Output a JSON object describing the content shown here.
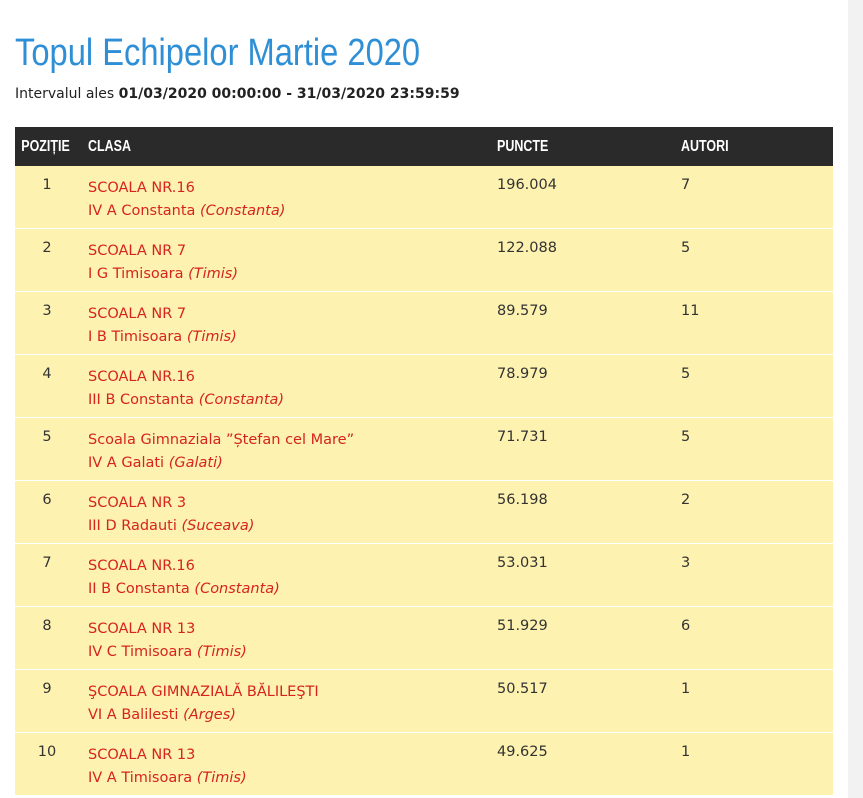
{
  "page": {
    "title": "Topul Echipelor Martie 2020",
    "interval_label": "Intervalul ales",
    "interval_range": "01/03/2020 00:00:00 - 31/03/2020 23:59:59"
  },
  "colors": {
    "title": "#2f8fd6",
    "header_bg": "#2a2a2a",
    "row_bg": "#fdf2b0",
    "link": "#d6241d"
  },
  "table": {
    "headers": {
      "position": "POZIȚIE",
      "class": "CLASA",
      "points": "PUNCTE",
      "authors": "AUTORI"
    },
    "rows": [
      {
        "position": "1",
        "school": "SCOALA NR.16",
        "class": "IV A Constanta",
        "county": "(Constanta)",
        "points": "196.004",
        "authors": "7"
      },
      {
        "position": "2",
        "school": "SCOALA NR 7",
        "class": "I G Timisoara",
        "county": "(Timis)",
        "points": "122.088",
        "authors": "5"
      },
      {
        "position": "3",
        "school": "SCOALA NR 7",
        "class": "I B Timisoara",
        "county": "(Timis)",
        "points": "89.579",
        "authors": "11"
      },
      {
        "position": "4",
        "school": "SCOALA NR.16",
        "class": "III B Constanta",
        "county": "(Constanta)",
        "points": "78.979",
        "authors": "5"
      },
      {
        "position": "5",
        "school": "Scoala Gimnaziala ”Ștefan cel Mare”",
        "class": "IV A Galati",
        "county": "(Galati)",
        "points": "71.731",
        "authors": "5"
      },
      {
        "position": "6",
        "school": "SCOALA NR 3",
        "class": "III D Radauti",
        "county": "(Suceava)",
        "points": "56.198",
        "authors": "2"
      },
      {
        "position": "7",
        "school": "SCOALA NR.16",
        "class": "II B Constanta",
        "county": "(Constanta)",
        "points": "53.031",
        "authors": "3"
      },
      {
        "position": "8",
        "school": "SCOALA NR 13",
        "class": "IV C Timisoara",
        "county": "(Timis)",
        "points": "51.929",
        "authors": "6"
      },
      {
        "position": "9",
        "school": "ŞCOALA GIMNAZIALĂ BĂLILEŞTI",
        "class": "VI A Balilesti",
        "county": "(Arges)",
        "points": "50.517",
        "authors": "1"
      },
      {
        "position": "10",
        "school": "SCOALA NR 13",
        "class": "IV A Timisoara",
        "county": "(Timis)",
        "points": "49.625",
        "authors": "1"
      }
    ]
  }
}
